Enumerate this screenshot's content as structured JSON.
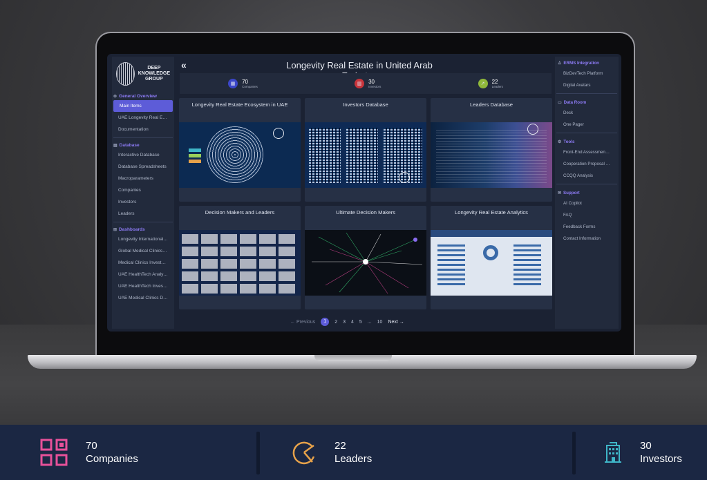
{
  "sidebar_left": {
    "logo": [
      "DEEP",
      "KNOWLEDGE",
      "GROUP"
    ],
    "sections": [
      {
        "title": "General Overview",
        "icon": "info-icon",
        "items": [
          "Main Items",
          "UAE Longevity Real Estate",
          "Documentation"
        ]
      },
      {
        "title": "Database",
        "icon": "database-icon",
        "items": [
          "Interactive Database",
          "Database Spreadsheets",
          "Macroparameters",
          "Companies",
          "Investors",
          "Leaders"
        ]
      },
      {
        "title": "Dashboards",
        "icon": "dashboard-icon",
        "items": [
          "Longevity International ...",
          "Global Medical Clinics In...",
          "Medical Clinics Investme...",
          "UAE HealthTech Analytic...",
          "UAE HealthTech Investm...",
          "UAE Medical Clinics Das..."
        ]
      }
    ],
    "active_item": "Main Items"
  },
  "header": {
    "collapse_glyph": "«",
    "title": "Longevity Real Estate in United Arab Emirates"
  },
  "stats": [
    {
      "value": "70",
      "label": "Companies",
      "color": "#3b46c9"
    },
    {
      "value": "30",
      "label": "Investors",
      "color": "#c8343b"
    },
    {
      "value": "22",
      "label": "Leaders",
      "color": "#8fb83a"
    }
  ],
  "cards": [
    {
      "title": "Longevity Real Estate Ecosystem in UAE"
    },
    {
      "title": "Investors Database"
    },
    {
      "title": "Leaders Database"
    },
    {
      "title": "Decision Makers and Leaders"
    },
    {
      "title": "Ultimate Decision Makers"
    },
    {
      "title": "Longevity Real Estate Analytics"
    }
  ],
  "pagination": {
    "prev": "← Previous",
    "pages": [
      "1",
      "2",
      "3",
      "4",
      "5",
      "...",
      "10"
    ],
    "current": "1",
    "next": "Next →"
  },
  "sidebar_right": {
    "sections": [
      {
        "title": "ERMS Integration",
        "icon": "user-icon",
        "items": [
          "BizDevTech Platform",
          "Digital Avatars"
        ]
      },
      {
        "title": "Data Room",
        "icon": "folder-icon",
        "items": [
          "Deck",
          "One Pager"
        ]
      },
      {
        "title": "Tools",
        "icon": "tools-icon",
        "items": [
          "Front-End Assessment T...",
          "Cooperation Proposal G...",
          "CCQQ Analysis"
        ]
      },
      {
        "title": "Support",
        "icon": "mail-icon",
        "items": [
          "AI Copilot",
          "FAQ",
          "Feedback Forms",
          "Contact Information"
        ]
      }
    ]
  },
  "footer_stats": [
    {
      "value": "70",
      "label": "Companies",
      "icon": "grid-squares-icon",
      "color": "#e8519a"
    },
    {
      "value": "22",
      "label": "Leaders",
      "icon": "pie-chart-icon",
      "color": "#e7a24a"
    },
    {
      "value": "30",
      "label": "Investors",
      "icon": "building-icon",
      "color": "#3fb6c8"
    }
  ]
}
